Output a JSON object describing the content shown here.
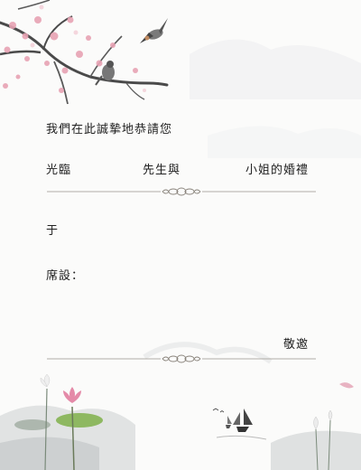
{
  "invitation": {
    "greeting": "我們在此誠摯地恭請您",
    "presence_label": "光臨",
    "mister_label": "先生與",
    "miss_wedding_label": "小姐的婚禮",
    "date_prefix": "于",
    "venue_prefix": "席設：",
    "signoff": "敬邀"
  },
  "colors": {
    "blossom": "#e8a3b4",
    "branch": "#4a4a4a",
    "ink_wash": "#c9cccd",
    "lotus_flower": "#e48aa8",
    "lotus_leaf": "#7fb04a",
    "divider": "#9a948c"
  },
  "decorations": {
    "top_left": [
      "plum-blossom-branch-icon",
      "bird-icon"
    ],
    "bottom": [
      "lotus-icon",
      "sailboat-icon",
      "mountain-wash-icon"
    ],
    "divider": "ornament-knot-icon"
  }
}
